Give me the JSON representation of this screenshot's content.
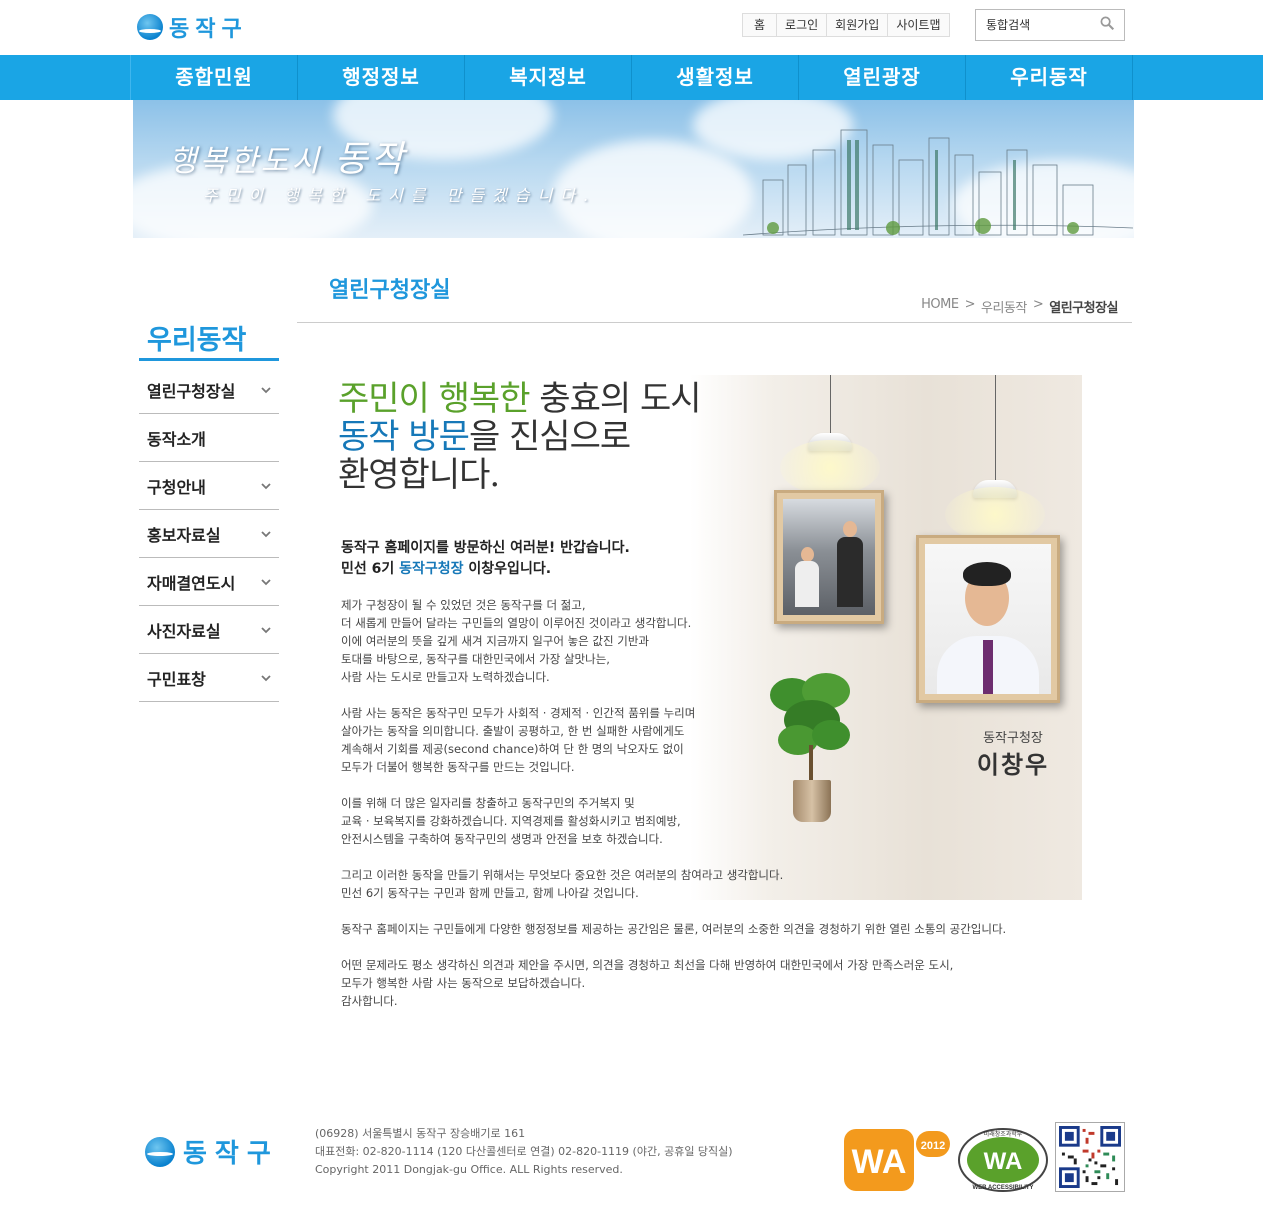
{
  "header": {
    "logo_text": "동작구",
    "util_links": [
      "홈",
      "로그인",
      "회원가입",
      "사이트맵"
    ],
    "search_placeholder": "통합검색"
  },
  "gnb": [
    "종합민원",
    "행정정보",
    "복지정보",
    "생활정보",
    "열린광장",
    "우리동작"
  ],
  "banner": {
    "title_small": "행복한도시",
    "title_big": "동작",
    "subtitle": "주민이 행복한 도시를 만들겠습니다."
  },
  "lnb": {
    "title": "우리동작",
    "items": [
      {
        "label": "열린구청장실",
        "expandable": true
      },
      {
        "label": "동작소개",
        "expandable": false
      },
      {
        "label": "구청안내",
        "expandable": true
      },
      {
        "label": "홍보자료실",
        "expandable": true
      },
      {
        "label": "자매결연도시",
        "expandable": true
      },
      {
        "label": "사진자료실",
        "expandable": true
      },
      {
        "label": "구민표창",
        "expandable": true
      }
    ]
  },
  "content": {
    "page_title": "열린구청장실",
    "breadcrumb": [
      "HOME",
      ">",
      "우리동작",
      ">",
      "열린구청장실"
    ],
    "headline": {
      "l1_green": "주민이 행복한",
      "l1_rest": " 충효의 도시",
      "l2_blue": "동작 방문",
      "l2_rest": "을 진심으로",
      "l3": "환영합니다."
    },
    "greeting": {
      "line1": "동작구 홈페이지를 방문하신 여러분! 반갑습니다.",
      "line2_a": "민선 6기 ",
      "line2_hl": "동작구청장",
      "line2_b": " 이창우입니다."
    },
    "paragraphs": [
      "제가 구청장이 될 수 있었던 것은 동작구를 더 젊고,\n더 새롭게 만들어 달라는 구민들의 열망이 이루어진 것이라고 생각합니다.\n이에 여러분의 뜻을 깊게 새겨 지금까지 일구어 놓은 값진 기반과\n토대를 바탕으로, 동작구를 대한민국에서 가장 살맛나는,\n사람 사는 도시로 만들고자 노력하겠습니다.",
      "사람 사는 동작은 동작구민 모두가 사회적 · 경제적 · 인간적 품위를 누리며\n살아가는 동작을 의미합니다. 출발이 공평하고, 한 번 실패한 사람에게도\n계속해서 기회를 제공(second chance)하여 단 한 명의 낙오자도 없이\n모두가 더불어 행복한 동작구를 만드는 것입니다.",
      "이를 위해 더 많은 일자리를 창출하고 동작구민의 주거복지 및\n교육 · 보육복지를 강화하겠습니다. 지역경제를 활성화시키고 범죄예방,\n안전시스템을 구축하여 동작구민의 생명과 안전을 보호 하겠습니다.",
      "그리고 이러한 동작을 만들기 위해서는 무엇보다 중요한 것은 여러분의 참여라고 생각합니다.\n민선 6기 동작구는 구민과 함께 만들고, 함께 나아갈 것입니다.",
      "동작구 홈페이지는 구민들에게 다양한 행정정보를 제공하는 공간임은 물론, 여러분의 소중한 의견을 경청하기 위한 열린 소통의 공간입니다.",
      "어떤 문제라도 평소 생각하신 의견과 제안을 주시면, 의견을 경청하고 최선을 다해 반영하여 대한민국에서 가장 만족스러운 도시,\n모두가 행복한 사람 사는 동작으로 보답하겠습니다.\n감사합니다."
    ],
    "mayor": {
      "title": "동작구청장",
      "name": "이창우"
    }
  },
  "footer": {
    "logo_text": "동작구",
    "address": "(06928) 서울특별시 동작구 장승배기로 161",
    "phone": "대표전화: 02-820-1114 (120 다산콜센터로 연결) 02-820-1119 (야간, 공휴일 당직실)",
    "copyright": "Copyright 2011 Dongjak-gu Office. ALL Rights reserved.",
    "badge_wa_year": "2012",
    "badge_wa_text": "WA",
    "badge_wa2_text": "WEB ACCESSIBILITY",
    "badge_wa2_top": "미래창조과학부"
  },
  "colors": {
    "brand_blue": "#1f97dc",
    "gnb_blue": "#1aa5e5",
    "headline_green": "#5aa12b",
    "headline_blue": "#1678b8"
  }
}
